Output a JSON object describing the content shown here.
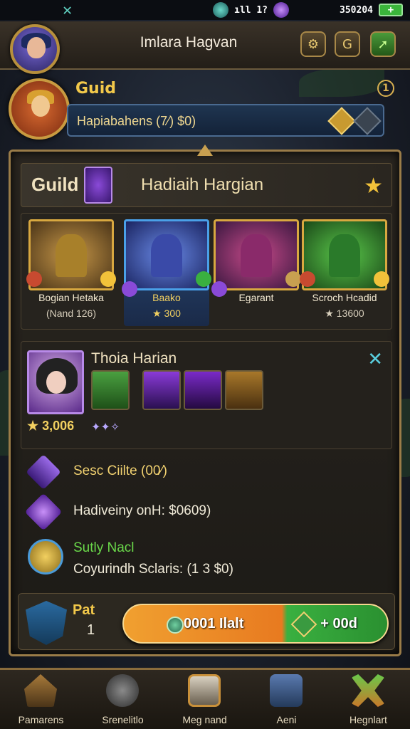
{
  "status_bar": {
    "close": "✕",
    "signal": "ıll 1?",
    "time": "3502‍04",
    "battery": "+"
  },
  "header": {
    "title": "Imlara Hagvan",
    "buttons": [
      "settings-gear",
      "help",
      "share"
    ]
  },
  "guild_banner": {
    "label": "Guid",
    "info": "1",
    "bar_text": "Hapiabahens (7⁄) $0)"
  },
  "panel": {
    "section_title": "Guild",
    "section_subtitle": "Hadiaih Hargian",
    "heroes": [
      {
        "name": "Bogian Hetaka",
        "sub": "(Nand 126)",
        "color": "gold"
      },
      {
        "name": "Baako",
        "sub": "★ 300",
        "color": "blue"
      },
      {
        "name": "Egarant",
        "sub": "",
        "color": "purple"
      },
      {
        "name": "Scroch Hcadid",
        "sub": "★ 13600",
        "color": "green"
      }
    ],
    "feature": {
      "title": "Thoia Harian",
      "score": "★ 3,006",
      "gems": "✦✦✧"
    },
    "rows": [
      {
        "text": "Sesc Ciilte (00⁄)"
      },
      {
        "text": "Hadiveiny onH: $0609)"
      },
      {
        "text": "Sutly Nacl",
        "text2": "Coyurindh Sclaris: (1 3  $0)"
      }
    ],
    "action": {
      "label": "Pat",
      "count": "1",
      "left_text": "0001 Ilalt",
      "right_text": "+ 00d"
    }
  },
  "bottom_nav": [
    {
      "label": "Pamarens"
    },
    {
      "label": "Srenelitlo"
    },
    {
      "label": "Meg nand"
    },
    {
      "label": "Aeni"
    },
    {
      "label": "Hegnlart"
    }
  ]
}
